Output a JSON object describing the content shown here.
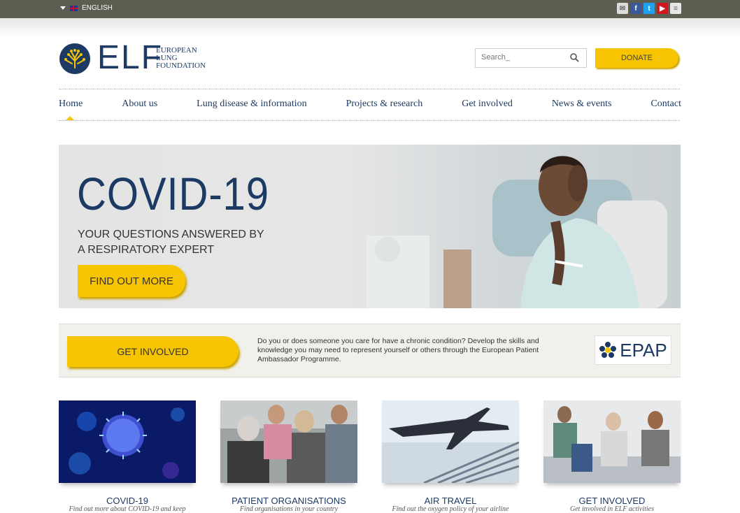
{
  "topbar": {
    "language": "ENGLISH",
    "social": [
      "email-icon",
      "facebook-icon",
      "twitter-icon",
      "youtube-icon",
      "rss-icon"
    ]
  },
  "header": {
    "logo_letters": "ELF",
    "logo_line1": "EUROPEAN",
    "logo_line2": "LUNG",
    "logo_line3": "FOUNDATION",
    "search_placeholder": "Search_",
    "donate_label": "DONATE"
  },
  "nav": {
    "items": [
      "Home",
      "About us",
      "Lung disease & information",
      "Projects & research",
      "Get involved",
      "News & events",
      "Contact"
    ],
    "active": "Home"
  },
  "hero": {
    "title": "COVID-19",
    "subtitle_line1": "YOUR QUESTIONS ANSWERED BY",
    "subtitle_line2": "A RESPIRATORY EXPERT",
    "button_label": "FIND OUT MORE"
  },
  "epap": {
    "button_label": "GET INVOLVED",
    "text": "Do you or does someone you care for have a chronic condition? Develop the skills and knowledge you may need to represent yourself or others through the European Patient Ambassador Programme.",
    "logo_text": "EPAP"
  },
  "tiles": [
    {
      "title": "COVID-19",
      "desc": "Find out more about COVID-19 and keep"
    },
    {
      "title": "PATIENT ORGANISATIONS",
      "desc": "Find organisations in your country"
    },
    {
      "title": "AIR TRAVEL",
      "desc": "Find out the oxygen policy of your airline"
    },
    {
      "title": "GET INVOLVED",
      "desc": "Get involved in ELF activities"
    }
  ],
  "colors": {
    "brand_navy": "#1c3a63",
    "accent_yellow": "#f6c400",
    "topbar": "#5d5d52"
  }
}
